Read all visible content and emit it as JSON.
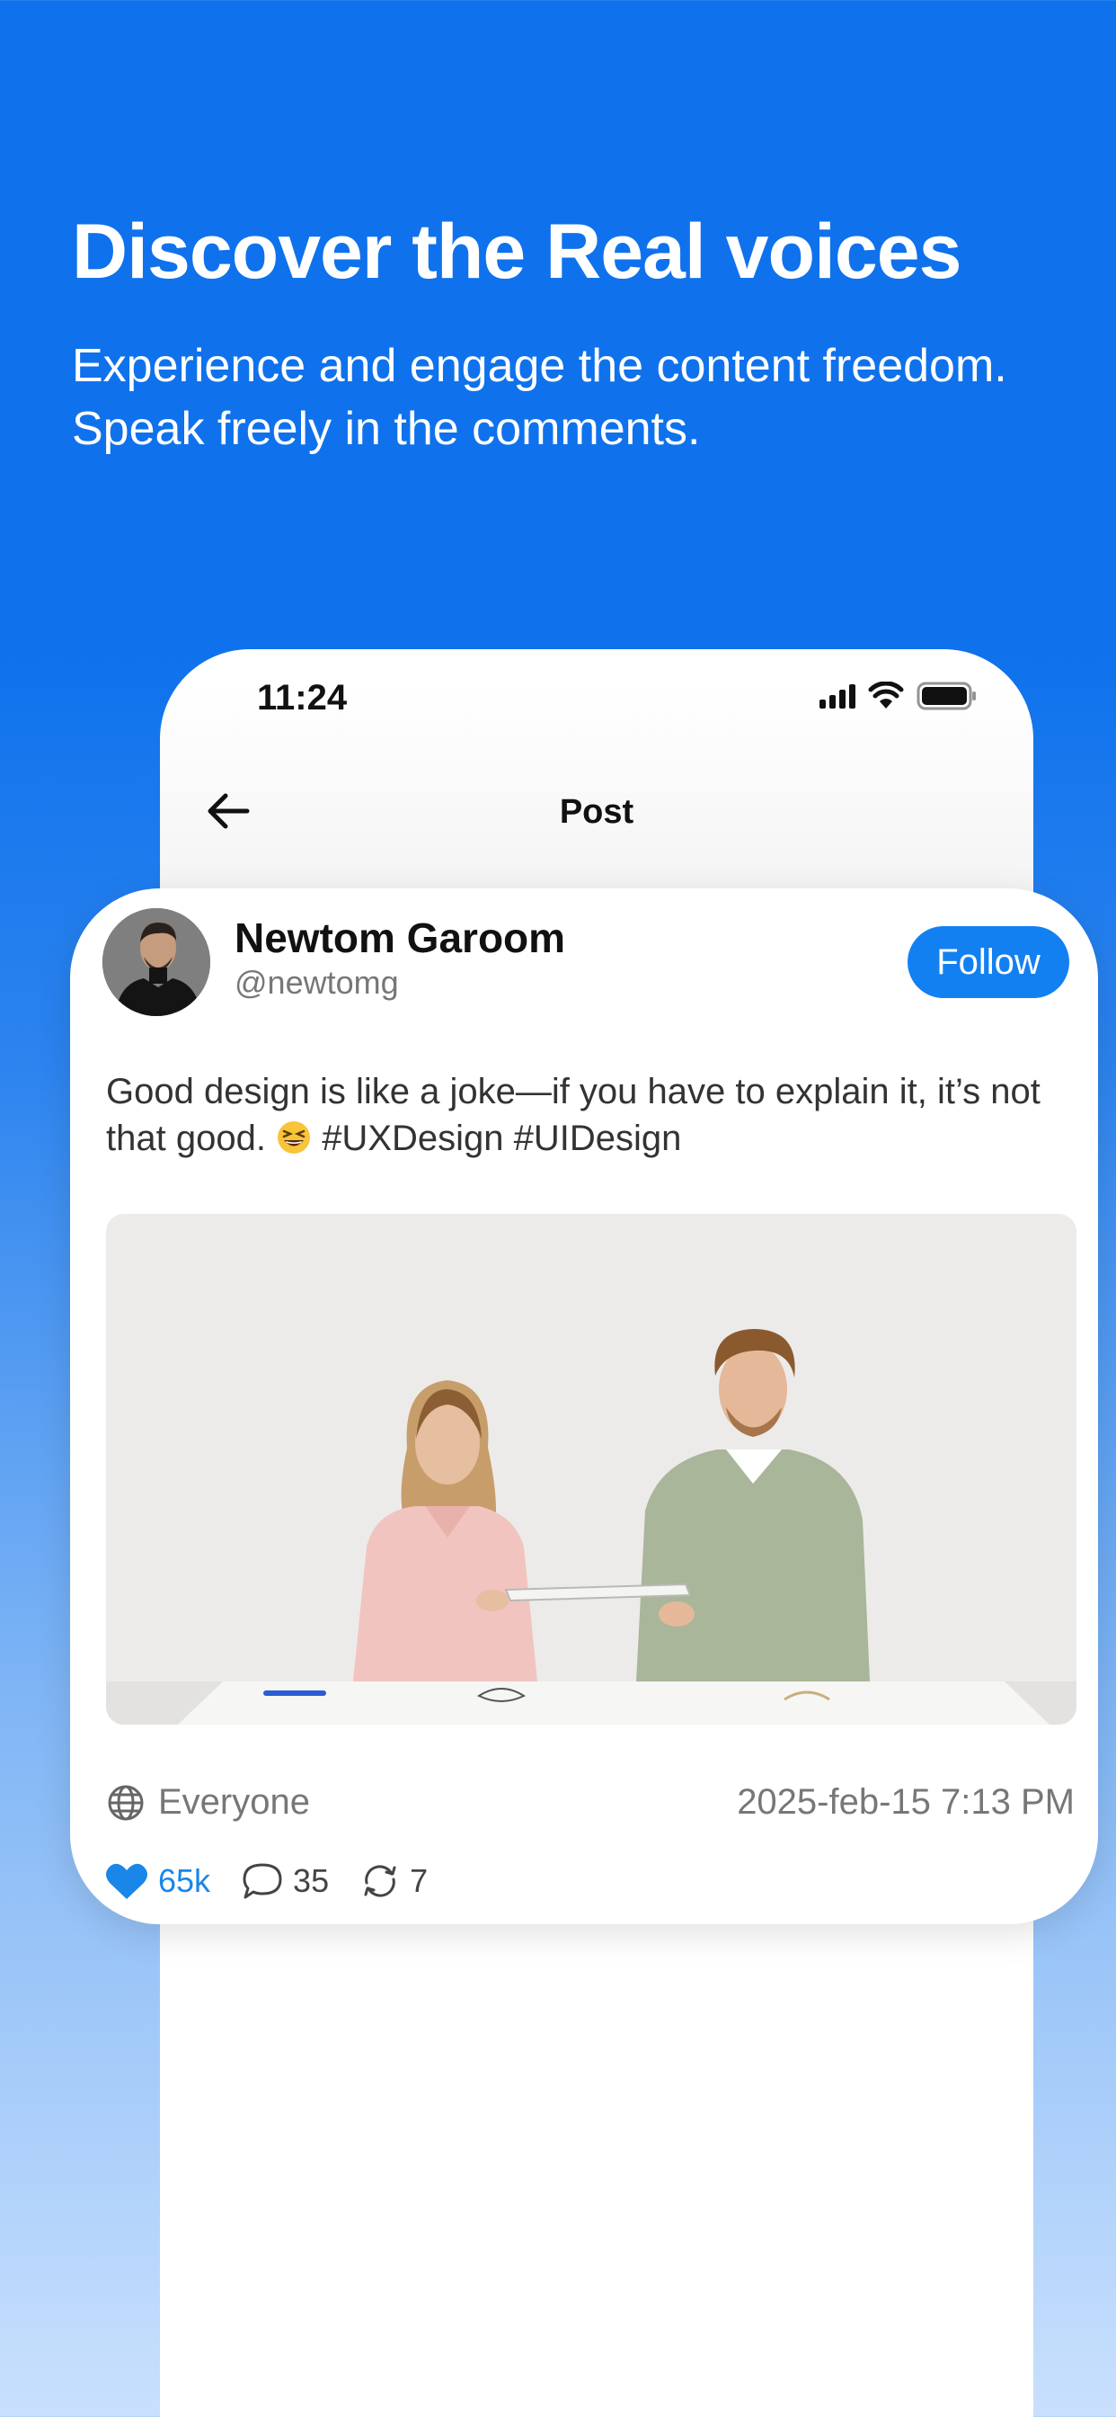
{
  "hero": {
    "title": "Discover the Real voices",
    "subtitle": "Experience and engage the content freedom. Speak freely in the comments."
  },
  "status_bar": {
    "time": "11:24",
    "icons": [
      "signal-icon",
      "wifi-icon",
      "battery-icon"
    ]
  },
  "nav": {
    "back_icon": "arrow-left-icon",
    "title": "Post"
  },
  "post": {
    "author": {
      "name": "Newtom Garoom",
      "handle": "@newtomg"
    },
    "follow_label": "Follow",
    "text_before_emoji": "Good design is like a joke—if you have to explain it, it’s not that good.",
    "emoji": "grinning-squinting-face",
    "hashtags": "#UXDesign #UIDesign",
    "audience": "Everyone",
    "date": "2025-feb-15 7:13 PM",
    "stats": {
      "likes": "65k",
      "comments": "35",
      "reposts": "7"
    }
  },
  "colors": {
    "brand_blue": "#0f72ec",
    "follow_button": "#1380f2",
    "like_blue": "#1a86e8"
  }
}
